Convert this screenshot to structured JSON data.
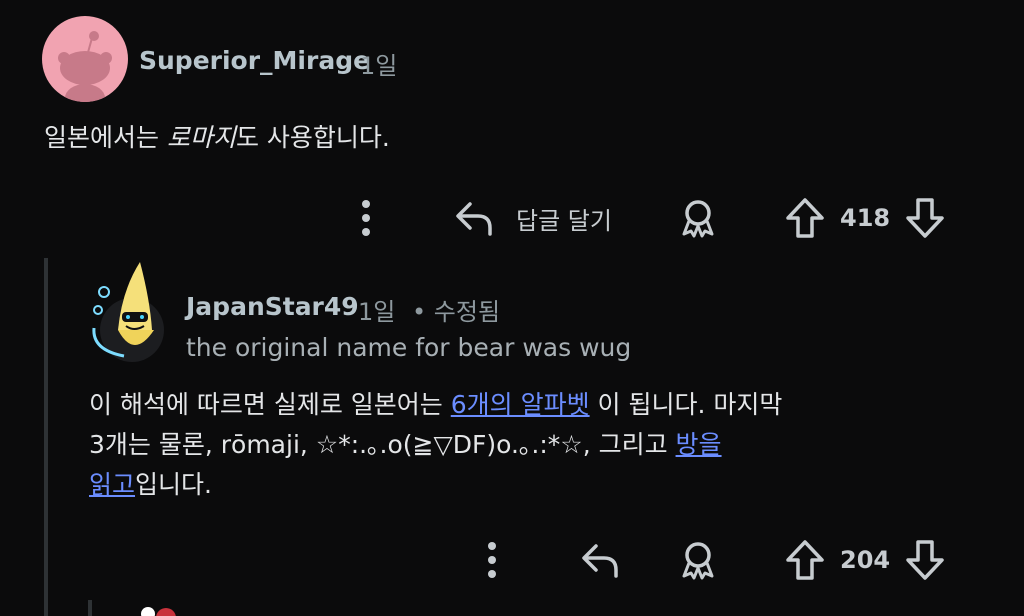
{
  "comment1": {
    "username": "Superior_Mirage",
    "time": "1일",
    "text_before": "일본에서는 ",
    "text_em": "로마지",
    "text_after": "도 사용합니다.",
    "reply_label": "답글 달기",
    "score": "418"
  },
  "comment2": {
    "username": "JapanStar49",
    "time": "1일",
    "edited": "• 수정됨",
    "flair": "the original name for bear was wug",
    "text_part1": "이 해석에 따르면 실제로 일본어는 ",
    "link1": "6개의 알파벳",
    "text_part2": " 이 됩니다. 마지막",
    "text_line2": "3개는 물론, rōmaji, ☆*:.｡.o(≧▽DF)o.｡.:*☆, 그리고 ",
    "link2_a": "방을",
    "link2_b": "읽고",
    "text_line3_tail": "입니다.",
    "score": "204"
  },
  "colors": {
    "background": "#0b0b0c",
    "link": "#6b8dff",
    "avatar_pink": "#f1a3b1"
  }
}
